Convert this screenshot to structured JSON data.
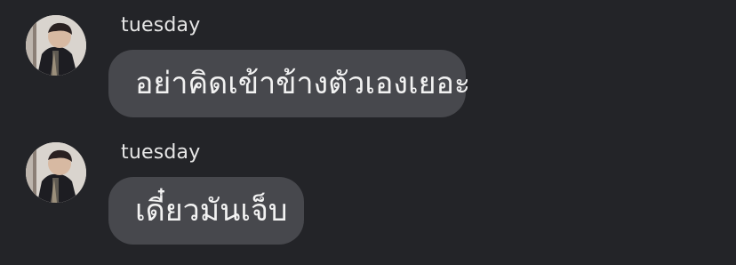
{
  "messages": [
    {
      "username": "tuesday",
      "text": "อย่าคิดเข้าข้างตัวเองเยอะ",
      "avatar_icon": "user-avatar"
    },
    {
      "username": "tuesday",
      "text": "เดี๋ยวมันเจ็บ",
      "avatar_icon": "user-avatar"
    }
  ],
  "colors": {
    "background": "#232428",
    "bubble": "#47484d",
    "text": "#f2f2f2",
    "username": "#e6e6e6"
  }
}
